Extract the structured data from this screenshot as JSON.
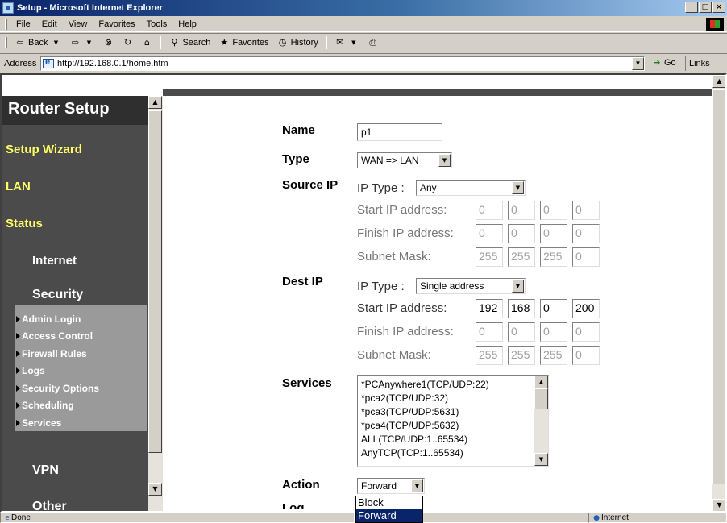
{
  "window": {
    "title": "Setup - Microsoft Internet Explorer",
    "controls": [
      "_",
      "□",
      "×"
    ]
  },
  "menu": [
    "File",
    "Edit",
    "View",
    "Favorites",
    "Tools",
    "Help"
  ],
  "toolbar": {
    "back": "Back",
    "search": "Search",
    "favorites": "Favorites",
    "history": "History"
  },
  "address": {
    "label": "Address",
    "url": "http://192.168.0.1/home.htm",
    "go": "Go",
    "links": "Links"
  },
  "sidebar": {
    "title": "Router Setup",
    "items": [
      {
        "label": "Setup Wizard"
      },
      {
        "label": "LAN"
      },
      {
        "label": "Status"
      }
    ],
    "status_sub": [
      "Internet",
      "Security"
    ],
    "security_links": [
      "Admin Login",
      "Access Control",
      "Firewall Rules",
      "Logs",
      "Security Options",
      "Scheduling",
      "Services"
    ],
    "lower": [
      "VPN",
      "Other"
    ]
  },
  "form": {
    "name": {
      "label": "Name",
      "value": "p1"
    },
    "type": {
      "label": "Type",
      "value": "WAN => LAN"
    },
    "source": {
      "label": "Source IP",
      "ip_type_label": "IP Type :",
      "ip_type_value": "Any",
      "start_label": "Start IP address:",
      "start": [
        "0",
        "0",
        "0",
        "0"
      ],
      "finish_label": "Finish IP address:",
      "finish": [
        "0",
        "0",
        "0",
        "0"
      ],
      "mask_label": "Subnet Mask:",
      "mask": [
        "255",
        "255",
        "255",
        "0"
      ]
    },
    "dest": {
      "label": "Dest IP",
      "ip_type_label": "IP Type :",
      "ip_type_value": "Single address",
      "start_label": "Start IP address:",
      "start": [
        "192",
        "168",
        "0",
        "200"
      ],
      "finish_label": "Finish IP address:",
      "finish": [
        "0",
        "0",
        "0",
        "0"
      ],
      "mask_label": "Subnet Mask:",
      "mask": [
        "255",
        "255",
        "255",
        "0"
      ]
    },
    "services": {
      "label": "Services",
      "items": [
        "*PCAnywhere1(TCP/UDP:22)",
        "*pca2(TCP/UDP:32)",
        "*pca3(TCP/UDP:5631)",
        "*pca4(TCP/UDP:5632)",
        "ALL(TCP/UDP:1..65534)",
        "AnyTCP(TCP:1..65534)"
      ]
    },
    "action": {
      "label": "Action",
      "value": "Forward",
      "options": [
        "Block",
        "Forward"
      ],
      "highlighted": "Forward"
    },
    "log": {
      "label": "Log"
    }
  },
  "status": {
    "text": "Done",
    "zone": "Internet"
  }
}
